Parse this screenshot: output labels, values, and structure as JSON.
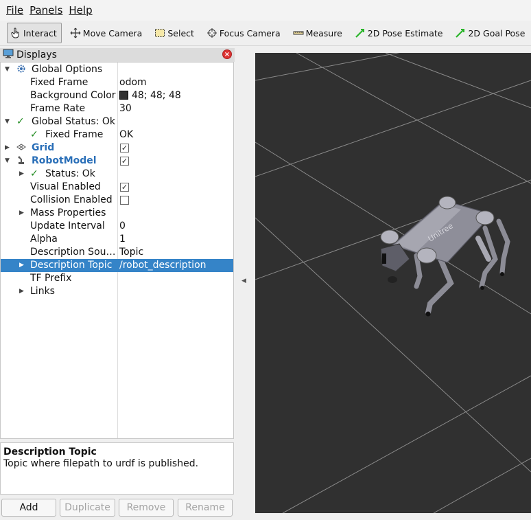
{
  "menu": {
    "file": "File",
    "panels": "Panels",
    "help": "Help"
  },
  "toolbar": {
    "interact": "Interact",
    "move_camera": "Move Camera",
    "select": "Select",
    "focus_camera": "Focus Camera",
    "measure": "Measure",
    "pose_estimate": "2D Pose Estimate",
    "goal_pose": "2D Goal Pose"
  },
  "displays": {
    "title": "Displays",
    "rows": {
      "global_options": "Global Options",
      "fixed_frame": "Fixed Frame",
      "fixed_frame_val": "odom",
      "background_color": "Background Color",
      "background_color_val": "48; 48; 48",
      "frame_rate": "Frame Rate",
      "frame_rate_val": "30",
      "global_status": "Global Status: Ok",
      "status_fixed_frame": "Fixed Frame",
      "status_fixed_frame_val": "OK",
      "grid": "Grid",
      "robot_model": "RobotModel",
      "rm_status": "Status: Ok",
      "visual_enabled": "Visual Enabled",
      "collision_enabled": "Collision Enabled",
      "mass_properties": "Mass Properties",
      "update_interval": "Update Interval",
      "update_interval_val": "0",
      "alpha": "Alpha",
      "alpha_val": "1",
      "description_source": "Description Sou…",
      "description_source_val": "Topic",
      "description_topic": "Description Topic",
      "description_topic_val": "/robot_description",
      "tf_prefix": "TF Prefix",
      "links": "Links"
    },
    "checks": {
      "grid": true,
      "robot_model": true,
      "visual_enabled": true,
      "collision_enabled": false
    }
  },
  "help": {
    "title": "Description Topic",
    "text": "Topic where filepath to urdf is published."
  },
  "buttons": {
    "add": "Add",
    "duplicate": "Duplicate",
    "remove": "Remove",
    "rename": "Rename"
  },
  "viewport": {
    "background": "#303030",
    "robot_label": "Unitree"
  }
}
